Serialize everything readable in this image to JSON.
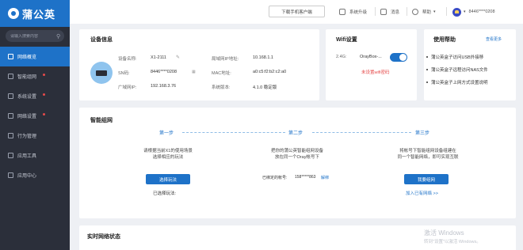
{
  "brand": {
    "name": "蒲公英"
  },
  "sidebar": {
    "search_placeholder": "请输入搜索内容",
    "items": [
      {
        "label": "网络概览",
        "active": true,
        "dot": false
      },
      {
        "label": "智能组网",
        "active": false,
        "dot": true
      },
      {
        "label": "系统设置",
        "active": false,
        "dot": true
      },
      {
        "label": "网络设置",
        "active": false,
        "dot": true
      },
      {
        "label": "行为管理",
        "active": false,
        "dot": false
      },
      {
        "label": "应用工具",
        "active": false,
        "dot": false
      },
      {
        "label": "应用中心",
        "active": false,
        "dot": false
      }
    ]
  },
  "topbar": {
    "download_label": "下载手机客户端",
    "upgrade_label": "系统升级",
    "message_label": "消息",
    "help_label": "帮助",
    "account": "8446****0208"
  },
  "device_info": {
    "title": "设备信息",
    "rows": [
      {
        "label": "设备名称:",
        "value": "X1-2111"
      },
      {
        "label": "SN码:",
        "value": "8446****0208"
      },
      {
        "label": "广域网IP:",
        "value": "192.168.3.76"
      }
    ],
    "rows_right": [
      {
        "label": "局域网IP地址:",
        "value": "10.168.1.1"
      },
      {
        "label": "MAC地址:",
        "value": "a0:c5:f2:b2:c2:a0"
      },
      {
        "label": "系统版本:",
        "value": "4.1.0 稳定版"
      }
    ]
  },
  "wifi": {
    "title": "Wifi设置",
    "band": "2.4G:",
    "ssid": "OrayBox-...",
    "enabled": true,
    "warning": "未设置wifi密码"
  },
  "help": {
    "title": "使用帮助",
    "more": "查看更多",
    "items": [
      "蒲公英盒子访问USB外接移",
      "蒲公英盒子远程访问NAS文件",
      "蒲公英盒子上网方式设置说明"
    ]
  },
  "smart_net": {
    "title": "智能组网",
    "steps": [
      {
        "title": "第一步",
        "desc1": "请根据当前X1的使用场景",
        "desc2": "选择相应的玩法",
        "button": "选择玩法",
        "sub": "已选择玩法:"
      },
      {
        "title": "第二步",
        "desc1": "把你的蒲公英智能组网设备",
        "desc2": "放在同一个Oray帐号下",
        "bound_label": "已绑定的帐号:",
        "bound_value": "158*****863",
        "unbind": "解绑"
      },
      {
        "title": "第三步",
        "desc1": "将帐号下智能组网设备组建在",
        "desc2": "同一个智能网络，即可实现互联",
        "button": "我要组网",
        "link": "加入已有网络 >>"
      }
    ]
  },
  "realtime": {
    "title": "实时网络状态"
  },
  "watermark": {
    "line1": "激活 Windows",
    "line2": "转到\"设置\"以激活 Windows。"
  },
  "colors": {
    "brand": "#1e72c8",
    "sidebar": "#2b2f3a",
    "warning": "#e64a4a"
  },
  "icons": {
    "upgrade": "monitor-icon",
    "message": "bell-icon",
    "help": "question-icon",
    "account": "avatar-icon"
  }
}
